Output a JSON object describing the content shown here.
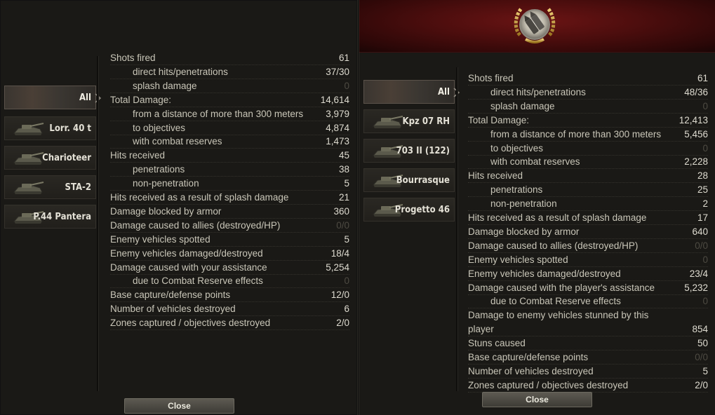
{
  "left": {
    "vehicles": [
      {
        "name": "All",
        "selected": true
      },
      {
        "name": "Lorr. 40 t",
        "icon": "tank-icon"
      },
      {
        "name": "Charioteer",
        "icon": "tank-icon"
      },
      {
        "name": "STA-2",
        "icon": "tank-icon"
      },
      {
        "name": "P.44 Pantera",
        "icon": "tank-icon"
      }
    ],
    "stats": [
      {
        "label": "Shots fired",
        "value": "61",
        "sub": false
      },
      {
        "label": "direct hits/penetrations",
        "value": "37/30",
        "sub": true
      },
      {
        "label": "splash damage",
        "value": "0",
        "sub": true,
        "dim": true
      },
      {
        "label": "Total Damage:",
        "value": "14,614",
        "sub": false
      },
      {
        "label": "from a distance of more than 300 meters",
        "value": "3,979",
        "sub": true
      },
      {
        "label": "to objectives",
        "value": "4,874",
        "sub": true
      },
      {
        "label": "with combat reserves",
        "value": "1,473",
        "sub": true
      },
      {
        "label": "Hits received",
        "value": "45",
        "sub": false
      },
      {
        "label": "penetrations",
        "value": "38",
        "sub": true
      },
      {
        "label": "non-penetration",
        "value": "5",
        "sub": true
      },
      {
        "label": "Hits received as a result of splash damage",
        "value": "21",
        "sub": false
      },
      {
        "label": "Damage blocked by armor",
        "value": "360",
        "sub": false
      },
      {
        "label": "Damage caused to allies (destroyed/HP)",
        "value": "0/0",
        "sub": false,
        "dim": true
      },
      {
        "label": "Enemy vehicles spotted",
        "value": "5",
        "sub": false
      },
      {
        "label": "Enemy vehicles damaged/destroyed",
        "value": "18/4",
        "sub": false
      },
      {
        "label": "Damage caused with your assistance",
        "value": "5,254",
        "sub": false
      },
      {
        "label": "due to Combat Reserve effects",
        "value": "0",
        "sub": true,
        "dim": true
      },
      {
        "label": "Base capture/defense points",
        "value": "12/0",
        "sub": false
      },
      {
        "label": "Number of vehicles destroyed",
        "value": "6",
        "sub": false
      },
      {
        "label": "Zones captured / objectives destroyed",
        "value": "2/0",
        "sub": false
      }
    ],
    "close_label": "Close"
  },
  "right": {
    "medal_icon": "medal-laurel-icon",
    "vehicles": [
      {
        "name": "All",
        "selected": true
      },
      {
        "name": "Kpz 07 RH",
        "icon": "tank-icon"
      },
      {
        "name": "703 II (122)",
        "icon": "tank-icon"
      },
      {
        "name": "Bourrasque",
        "icon": "tank-icon"
      },
      {
        "name": "Progetto 46",
        "icon": "tank-icon"
      }
    ],
    "stats": [
      {
        "label": "Shots fired",
        "value": "61",
        "sub": false
      },
      {
        "label": "direct hits/penetrations",
        "value": "48/36",
        "sub": true
      },
      {
        "label": "splash damage",
        "value": "0",
        "sub": true,
        "dim": true
      },
      {
        "label": "Total Damage:",
        "value": "12,413",
        "sub": false
      },
      {
        "label": "from a distance of more than 300 meters",
        "value": "5,456",
        "sub": true
      },
      {
        "label": "to objectives",
        "value": "0",
        "sub": true,
        "dim": true
      },
      {
        "label": "with combat reserves",
        "value": "2,228",
        "sub": true
      },
      {
        "label": "Hits received",
        "value": "28",
        "sub": false
      },
      {
        "label": "penetrations",
        "value": "25",
        "sub": true
      },
      {
        "label": "non-penetration",
        "value": "2",
        "sub": true
      },
      {
        "label": "Hits received as a result of splash damage",
        "value": "17",
        "sub": false
      },
      {
        "label": "Damage blocked by armor",
        "value": "640",
        "sub": false
      },
      {
        "label": "Damage caused to allies (destroyed/HP)",
        "value": "0/0",
        "sub": false,
        "dim": true
      },
      {
        "label": "Enemy vehicles spotted",
        "value": "0",
        "sub": false,
        "dim": true
      },
      {
        "label": "Enemy vehicles damaged/destroyed",
        "value": "23/4",
        "sub": false
      },
      {
        "label": "Damage caused with the player's assistance",
        "value": "5,232",
        "sub": false
      },
      {
        "label": "due to Combat Reserve effects",
        "value": "0",
        "sub": true,
        "dim": true
      },
      {
        "label": "Damage to enemy vehicles stunned by this",
        "value": "",
        "sub": false
      },
      {
        "label": "player",
        "value": "854",
        "sub": false
      },
      {
        "label": "Stuns caused",
        "value": "50",
        "sub": false
      },
      {
        "label": "Base capture/defense points",
        "value": "0/0",
        "sub": false,
        "dim": true
      },
      {
        "label": "Number of vehicles destroyed",
        "value": "5",
        "sub": false
      },
      {
        "label": "Zones captured / objectives destroyed",
        "value": "2/0",
        "sub": false
      }
    ],
    "close_label": "Close"
  },
  "colors": {
    "panel_bg": "#1a1916",
    "banner_red": "#6a1414",
    "text": "#c9c6b8",
    "dim_value": "#4d4a42"
  }
}
